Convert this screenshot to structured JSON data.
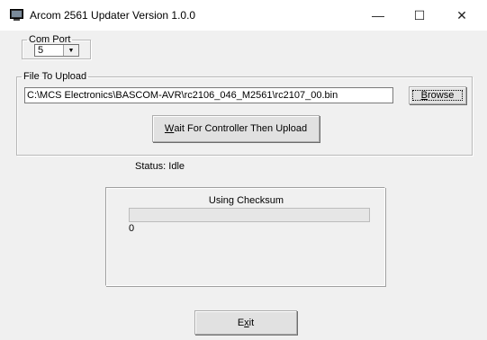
{
  "window": {
    "title": "Arcom 2561 Updater Version 1.0.0",
    "controls": {
      "minimize": "—",
      "maximize": "☐",
      "close": "✕"
    }
  },
  "com_port": {
    "legend": "Com Port",
    "selected": "5"
  },
  "file_upload": {
    "legend": "File To Upload",
    "path": "C:\\MCS Electronics\\BASCOM-AVR\\rc2106_046_M2561\\rc2107_00.bin",
    "browse_mnemonic": "B",
    "browse_rest": "rowse",
    "upload_mnemonic": "W",
    "upload_rest": "ait For Controller Then Upload"
  },
  "status": {
    "text": "Status: Idle"
  },
  "checksum": {
    "title": "Using Checksum",
    "progress_value": "0",
    "progress_fraction": 0
  },
  "exit": {
    "pre": "E",
    "mnemonic": "x",
    "post": "it"
  },
  "icons": {
    "app": "monitor-icon",
    "dropdown": "chevron-down-icon"
  }
}
